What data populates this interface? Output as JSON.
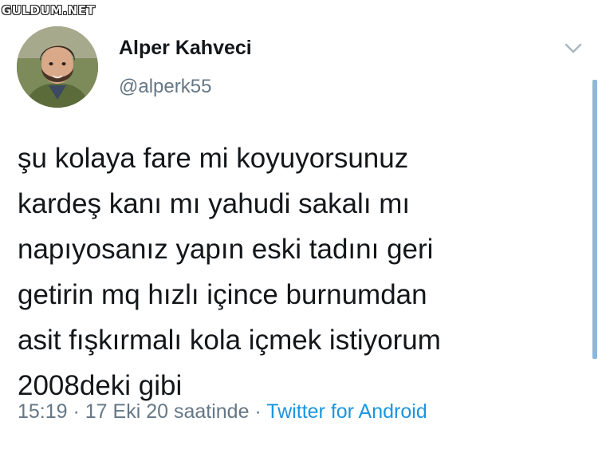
{
  "watermark": "GULDUM.NET",
  "author": {
    "name": "Alper Kahveci",
    "handle": "@alperk55",
    "avatar": "profile-photo"
  },
  "menu": {
    "icon": "chevron-down-icon"
  },
  "tweet": {
    "text": "şu kolaya fare mi koyuyorsunuz\nkardeş kanı mı yahudi sakalı mı\nnapıyosanız yapın eski tadını geri\ngetirin mq hızlı içince burnumdan\nasit fışkırmalı kola içmek istiyorum\n2008deki gibi"
  },
  "meta": {
    "time": "15:19",
    "separator1": " · ",
    "date": "17 Eki 20 saatinde",
    "separator2": " · ",
    "source": "Twitter for Android"
  },
  "colors": {
    "text": "#14171a",
    "muted": "#657786",
    "link": "#1b95e0",
    "scrollbar": "#8ab8de"
  }
}
